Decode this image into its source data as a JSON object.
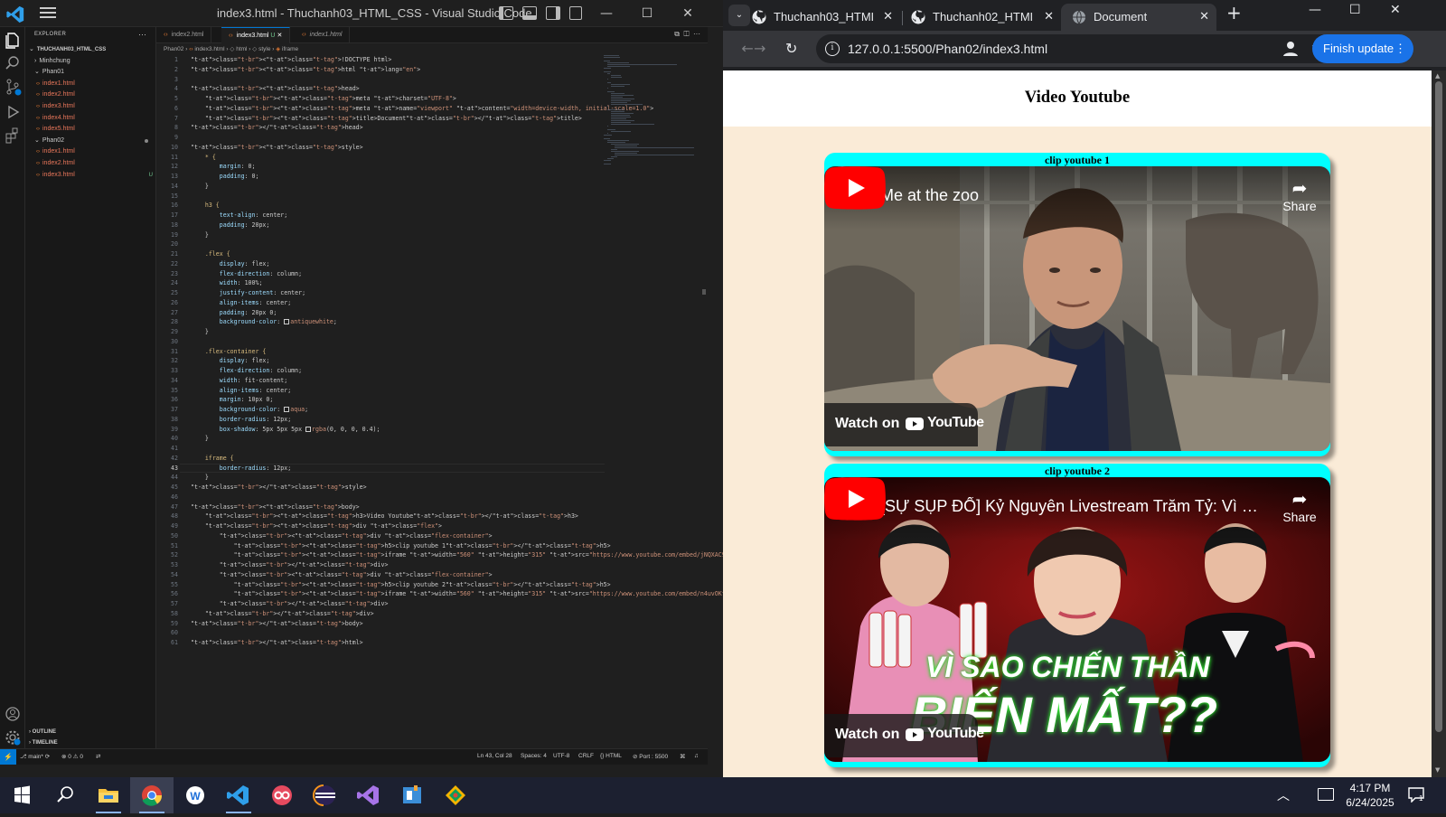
{
  "vscode": {
    "window_title": "index3.html - Thuchanh03_HTML_CSS - Visual Studio Code",
    "explorer": {
      "header": "EXPLORER",
      "root": "THUCHANH03_HTML_CSS",
      "folders": [
        {
          "name": "Minhchung",
          "expanded": false,
          "files": []
        },
        {
          "name": "Phan01",
          "expanded": true,
          "files": [
            "index1.html",
            "index2.html",
            "index3.html",
            "index4.html",
            "index5.html"
          ]
        },
        {
          "name": "Phan02",
          "expanded": true,
          "files": [
            "index1.html",
            "index2.html",
            "index3.html"
          ]
        }
      ],
      "untracked_badge": "U",
      "outline_label": "OUTLINE",
      "timeline_label": "TIMELINE"
    },
    "tabs": [
      {
        "label": "index2.html",
        "active": false
      },
      {
        "label": "index3.html",
        "active": true,
        "badge": "U"
      },
      {
        "label": "index1.html",
        "active": false
      }
    ],
    "breadcrumb": [
      "Phan02",
      "index3.html",
      "html",
      "style",
      "iframe"
    ],
    "current_line": 43,
    "code_lines": [
      "<!DOCTYPE html>",
      "<html lang=\"en\">",
      "",
      "<head>",
      "    <meta charset=\"UTF-8\">",
      "    <meta name=\"viewport\" content=\"width=device-width, initial-scale=1.0\">",
      "    <title>Document</title>",
      "</head>",
      "",
      "<style>",
      "    * {",
      "        margin: 0;",
      "        padding: 0;",
      "    }",
      "",
      "    h3 {",
      "        text-align: center;",
      "        padding: 20px;",
      "    }",
      "",
      "    .flex {",
      "        display: flex;",
      "        flex-direction: column;",
      "        width: 100%;",
      "        justify-content: center;",
      "        align-items: center;",
      "        padding: 20px 0;",
      "        background-color: ■antiquewhite;",
      "    }",
      "",
      "    .flex-container {",
      "        display: flex;",
      "        flex-direction: column;",
      "        width: fit-content;",
      "        align-items: center;",
      "        margin: 10px 0;",
      "        background-color: ■aqua;",
      "        border-radius: 12px;",
      "        box-shadow: 5px 5px 5px ■rgba(0, 0, 0, 0.4);",
      "    }",
      "",
      "    iframe {",
      "        border-radius: 12px;",
      "    }",
      "</style>",
      "",
      "<body>",
      "    <h3>Video Youtube</h3>",
      "    <div class=\"flex\">",
      "        <div class=\"flex-container\">",
      "            <h5>clip youtube 1</h5>",
      "            <iframe width=\"560\" height=\"315\" src=\"https://www.youtube.com/embed/jNQXAC9IVRw\" frameborder=",
      "        </div>",
      "        <div class=\"flex-container\">",
      "            <h5>clip youtube 2</h5>",
      "            <iframe width=\"560\" height=\"315\" src=\"https://www.youtube.com/embed/n4uvOKtJEAY\" frameborder=",
      "        </div>",
      "    </div>",
      "</body>",
      "",
      "</html>"
    ],
    "status": {
      "branch": "main*",
      "errors": "0",
      "warnings": "0",
      "cursor": "Ln 43, Col 28",
      "spaces": "Spaces: 4",
      "encoding": "UTF-8",
      "eol": "CRLF",
      "language": "HTML",
      "port": "Port : 5500"
    }
  },
  "chrome": {
    "tabs": [
      {
        "title": "Thuchanh03_HTML_C",
        "icon": "github-icon",
        "active": false
      },
      {
        "title": "Thuchanh02_HTML_C",
        "icon": "github-icon",
        "active": false
      },
      {
        "title": "Document",
        "icon": "globe-icon",
        "active": true
      }
    ],
    "url": "127.0.0.1:5500/Phan02/index3.html",
    "update_button": "Finish update",
    "page": {
      "heading": "Video Youtube",
      "videos": [
        {
          "caption": "clip youtube 1",
          "title": "Me at the zoo",
          "share": "Share",
          "watch_on": "Watch on",
          "brand": "YouTube"
        },
        {
          "caption": "clip youtube 2",
          "title": "[SỰ SỤP ĐỔ] Kỷ Nguyên Livestream Trăm Tỷ: Vì Sa...",
          "share": "Share",
          "watch_on": "Watch on",
          "brand": "YouTube",
          "thumb_line1": "VÌ SAO CHIẾN THẦN",
          "thumb_line2": "BIẾN MẤT??"
        }
      ]
    }
  },
  "taskbar": {
    "apps": [
      "windows-start-icon",
      "search-icon",
      "file-explorer-icon",
      "chrome-icon",
      "app-w-icon",
      "vscode-icon",
      "app-oo-icon",
      "eclipse-icon",
      "visual-studio-icon",
      "app-blue-icon",
      "git-app-icon"
    ],
    "time": "4:17 PM",
    "date": "6/24/2025",
    "notification_count": "1"
  },
  "colors": {
    "vscode_bg": "#1f1f1f",
    "accent_blue": "#0078d4",
    "page_bg": "#faebd7",
    "card_bg": "#00ffff",
    "youtube_red": "#ff0000",
    "chrome_update": "#1a73e8"
  }
}
